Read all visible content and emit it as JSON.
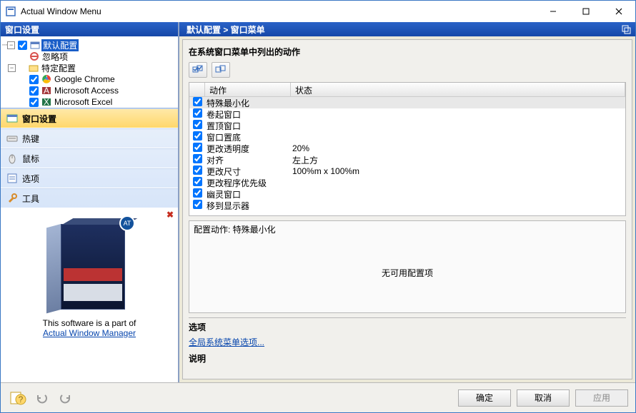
{
  "app": {
    "title": "Actual Window Menu"
  },
  "left": {
    "header": "窗口设置",
    "tree": {
      "root": "默认配置",
      "ignore": "忽略项",
      "specific": "特定配置",
      "apps": [
        "Google Chrome",
        "Microsoft Access",
        "Microsoft Excel"
      ]
    },
    "nav": {
      "window_settings": "窗口设置",
      "hotkeys": "热键",
      "mouse": "鼠标",
      "options": "选项",
      "tools": "工具"
    },
    "promo": {
      "text": "This software is a part of",
      "link": "Actual Window Manager",
      "badge": "AT"
    }
  },
  "right": {
    "breadcrumb": "默认配置 > 窗口菜单",
    "section_title": "在系统窗口菜单中列出的动作",
    "grid": {
      "col_action": "动作",
      "col_status": "状态",
      "rows": [
        {
          "action": "特殊最小化",
          "status": "",
          "checked": true,
          "selected": true
        },
        {
          "action": "卷起窗口",
          "status": "",
          "checked": true
        },
        {
          "action": "置顶窗口",
          "status": "",
          "checked": true
        },
        {
          "action": "窗口置底",
          "status": "",
          "checked": true
        },
        {
          "action": "更改透明度",
          "status": "20%",
          "checked": true
        },
        {
          "action": "对齐",
          "status": "左上方",
          "checked": true
        },
        {
          "action": "更改尺寸",
          "status": "100%m x 100%m",
          "checked": true
        },
        {
          "action": "更改程序优先级",
          "status": "",
          "checked": true
        },
        {
          "action": "幽灵窗口",
          "status": "",
          "checked": true
        },
        {
          "action": "移到显示器",
          "status": "",
          "checked": true
        }
      ]
    },
    "config": {
      "label_prefix": "配置动作: ",
      "label_value": "特殊最小化",
      "empty": "无可用配置项"
    },
    "options_title": "选项",
    "options_link": "全局系统菜单选项...",
    "desc_title": "说明"
  },
  "footer": {
    "ok": "确定",
    "cancel": "取消",
    "apply": "应用"
  }
}
